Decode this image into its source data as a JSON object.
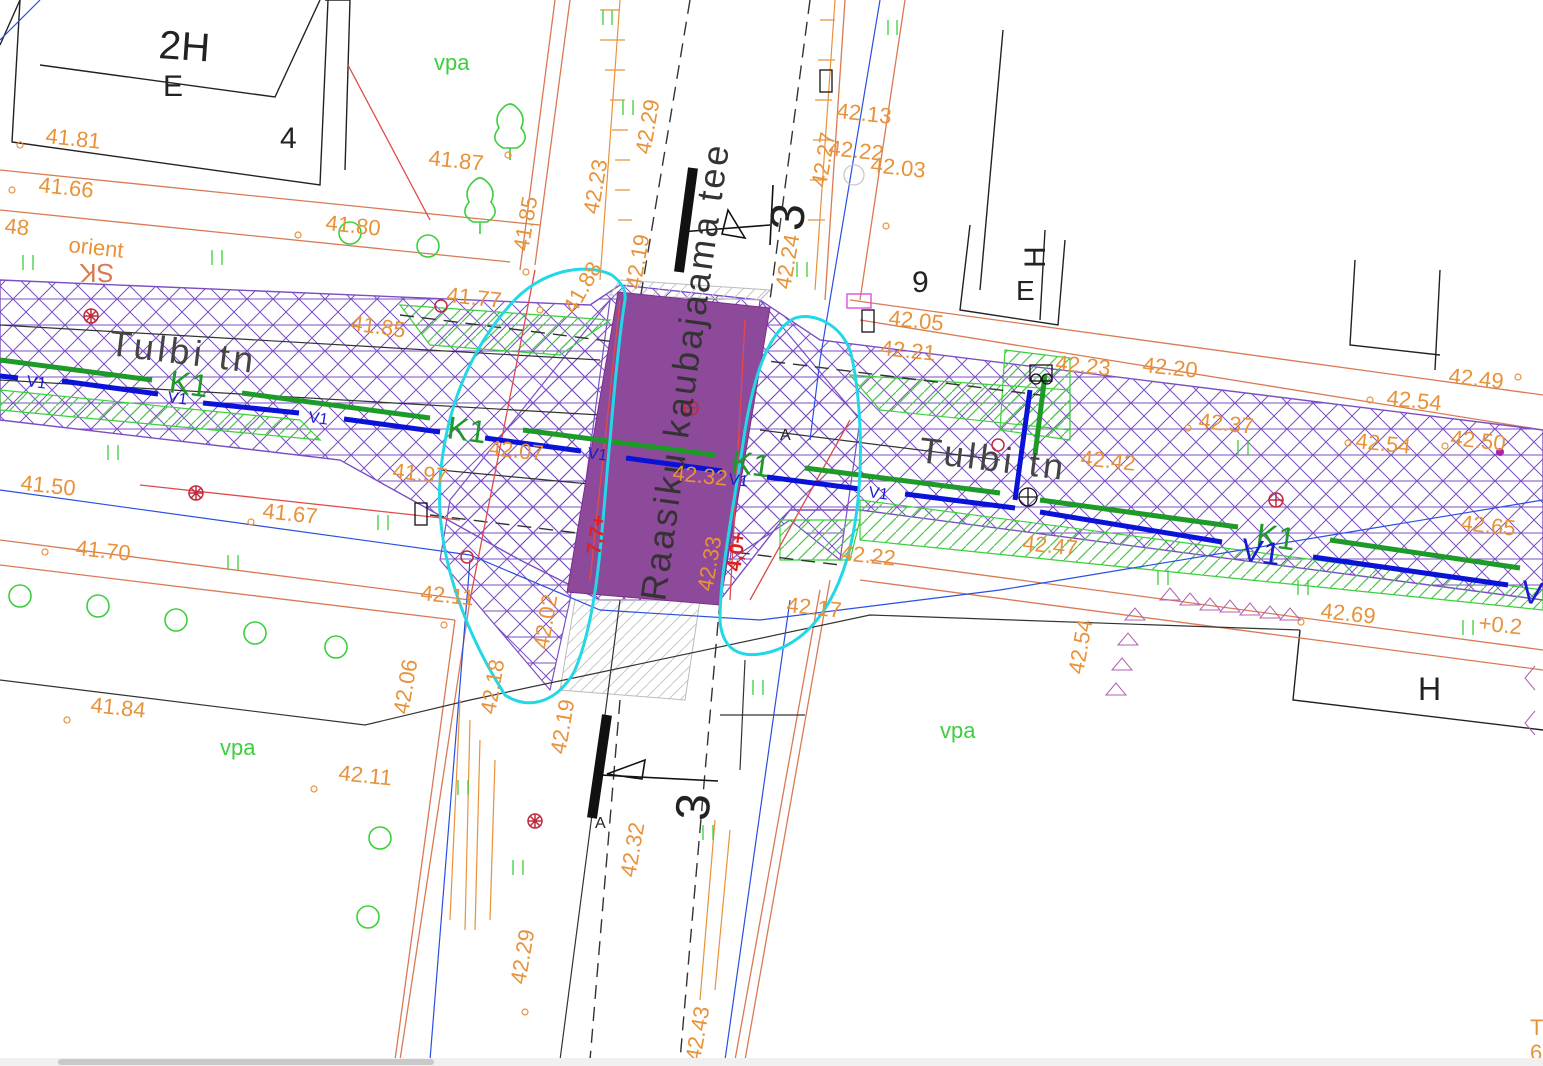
{
  "colors": {
    "road_hatch": "#7b4fc4",
    "crossing_fill": "#8e4a9a",
    "green_hatch": "#3ccf3c",
    "blue_line": "#0a12d8",
    "green_line": "#1e9a28",
    "cyan_marker": "#22d8e6",
    "orange_text": "#e8923a",
    "red_line": "#e04a4a"
  },
  "map": {
    "street_labels": {
      "tulbi_left": "Tulbi tn",
      "tulbi_right": "Tulbi tn",
      "raasiku": "Raasiku kaubajaama tee"
    },
    "section_labels": {
      "section_top": "3",
      "section_bottom": "3",
      "letter_top": "A",
      "letter_bottom": "A"
    },
    "building_labels": {
      "b_2h": "2H",
      "b_2h_e": "E",
      "b_4": "4",
      "b_9": "9",
      "b_h_right": "H",
      "b_h_right_e": "E",
      "b_h_bottom": "H"
    },
    "area_labels": {
      "vpa_top": "vpa",
      "vpa_bottom_left": "vpa",
      "vpa_bottom_right": "vpa",
      "orient": "orient",
      "sk": "SK"
    },
    "utility_labels": {
      "k1_a": "K1",
      "k1_b": "K1",
      "k1_c": "K1",
      "k1_d": "K1",
      "v1_big": "V1",
      "v1_edge": "V",
      "v1_s1": "V1",
      "v1_s2": "V1",
      "v1_s3": "V1",
      "v1_s4": "V1",
      "v1_s5": "V1",
      "v1_s6": "V1"
    },
    "red_marks": {
      "left": "7,7+",
      "right": "4,0+"
    },
    "elevations": {
      "e01": "41.81",
      "e02": "41.66",
      "e03": "48",
      "e04": "41.87",
      "e05": "41.80",
      "e06": "41.85",
      "e07": "42.23",
      "e08": "42.29",
      "e09": "42.13",
      "e10": "42.27",
      "e11": "42.22",
      "e12": "42.03",
      "e13": "41.77",
      "e14": "41.88",
      "e15": "42.19",
      "e16": "42.24",
      "e17": "41.85",
      "e18": "42.05",
      "e19": "42.21",
      "e20": "42.23",
      "e21": "42.20",
      "e22": "42.49",
      "e23": "42.54",
      "e24": "42.37",
      "e25": "42.54",
      "e26": "42.50",
      "e27": "41.50",
      "e28": "41.67",
      "e29": "41.70",
      "e30": "42.11",
      "e31": "42.22",
      "e32": "42.17",
      "e33": "42.47",
      "e34": "42.69",
      "e35": "42.65",
      "e36": "+0.2",
      "e37": "41.84",
      "e38": "42.06",
      "e39": "42.18",
      "e40": "42.19",
      "e41": "42.11",
      "e42": "42.32",
      "e43": "42.29",
      "e44": "42.43",
      "e45": "42.54",
      "e46": "42.32",
      "e47": "42.33",
      "e48": "42.42",
      "e49": "42.02",
      "e50": "42.07",
      "e51": "41.97"
    },
    "edge_marks": {
      "tr_edge": "T",
      "tr_edge2": "6"
    }
  }
}
